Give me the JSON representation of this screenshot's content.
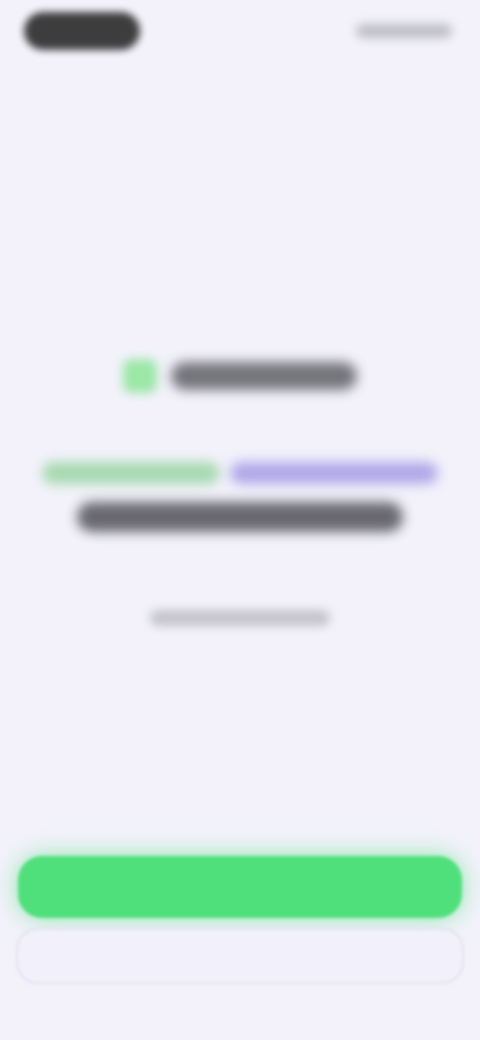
{
  "status_bar": {
    "left_label": "",
    "right_label": ""
  },
  "top_action": {
    "skip_label": ""
  },
  "brand": {
    "name": "",
    "icon": "brand-logo-icon"
  },
  "hero": {
    "headline_part_green": "",
    "headline_part_purple": "",
    "headline_line2": "",
    "subtext": ""
  },
  "actions": {
    "primary_label": "",
    "secondary_label": ""
  },
  "colors": {
    "background": "#f3f2fb",
    "accent_green": "#4fe07b",
    "accent_purple": "#a9a0e6",
    "text_dark": "#3a3a40"
  }
}
